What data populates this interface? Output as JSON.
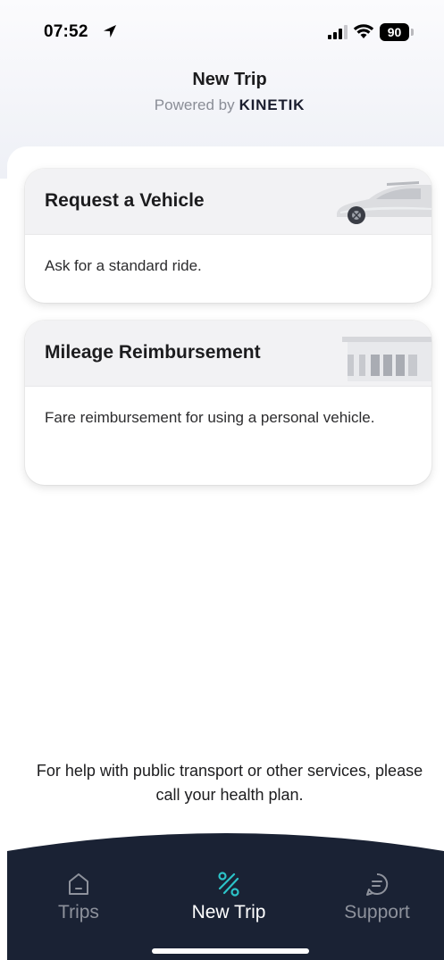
{
  "status_bar": {
    "time": "07:52",
    "battery_level": "90",
    "icons": [
      "location-arrow-icon",
      "signal-bars-icon",
      "wifi-icon",
      "battery-icon"
    ]
  },
  "header": {
    "title": "New Trip",
    "subtitle": "Powered by",
    "brand": "KINETIK"
  },
  "cards": [
    {
      "title": "Request a Vehicle",
      "description": "Ask for a standard ride.",
      "illustration": "car-illustration"
    },
    {
      "title": "Mileage Reimbursement",
      "description": "Fare reimbursement for using a personal vehicle.",
      "illustration": "gas-station-illustration"
    }
  ],
  "help_text": "For help with public transport or other services, please call your health plan.",
  "tabs": [
    {
      "label": "Trips",
      "icon": "home-icon",
      "active": false
    },
    {
      "label": "New Trip",
      "icon": "route-icon",
      "active": true
    },
    {
      "label": "Support",
      "icon": "chat-icon",
      "active": false
    }
  ],
  "colors": {
    "tab_bar_background": "#1a2234",
    "active_icon": "#2cc3c8",
    "inactive_label": "#8e929c",
    "card_header": "#f2f2f4"
  }
}
